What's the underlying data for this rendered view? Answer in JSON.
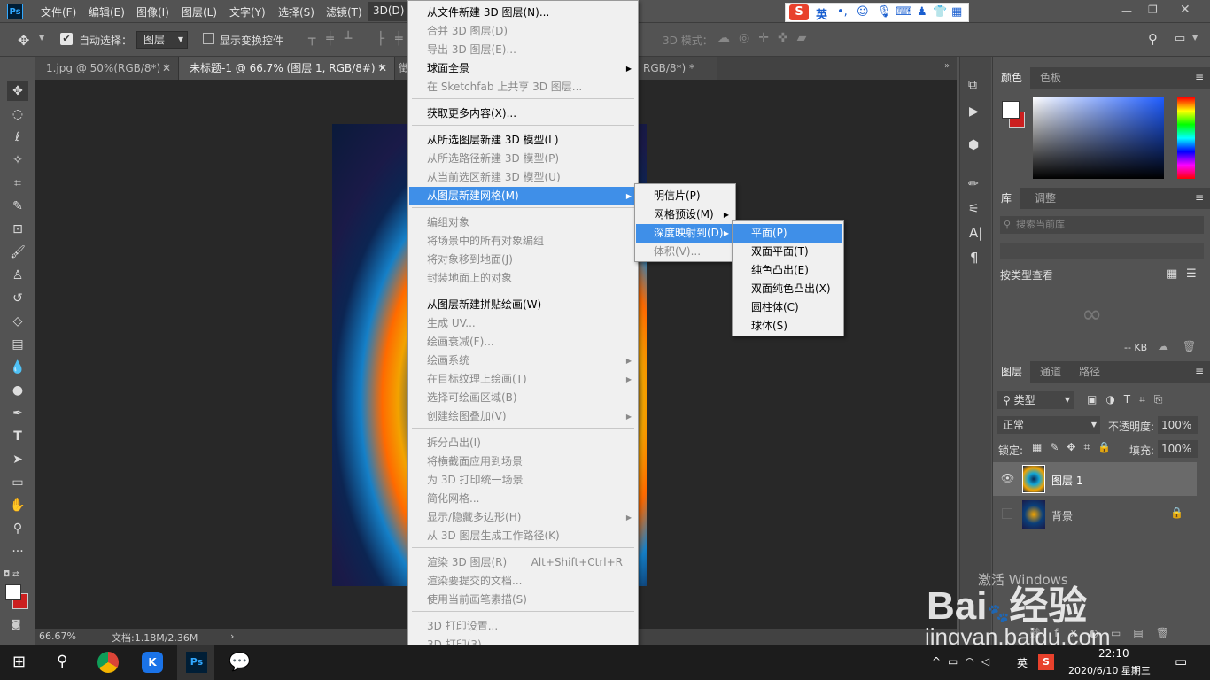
{
  "menubar": {
    "logo": "Ps",
    "items": [
      "文件(F)",
      "编辑(E)",
      "图像(I)",
      "图层(L)",
      "文字(Y)",
      "选择(S)",
      "滤镜(T)",
      "3D(D)"
    ]
  },
  "options": {
    "auto_select_label": "自动选择：",
    "auto_select_value": "图层",
    "show_transform_label": "显示变换控件",
    "mode_3d_label": "3D 模式："
  },
  "doc_tabs": [
    "1.jpg @ 50%(RGB/8*) *",
    "未标题-1 @ 66.7% (图层 1, RGB/8#) *",
    "徵",
    "RGB/8*) *"
  ],
  "status": {
    "zoom": "66.67%",
    "doc": "文档:1.18M/2.36M"
  },
  "menu_3d": {
    "items": [
      {
        "label": "从文件新建 3D 图层(N)...",
        "disabled": false
      },
      {
        "label": "合并 3D 图层(D)",
        "disabled": true
      },
      {
        "label": "导出 3D 图层(E)...",
        "disabled": true
      },
      {
        "label": "球面全景",
        "disabled": false,
        "submenu": true
      },
      {
        "label": "在 Sketchfab 上共享 3D 图层...",
        "disabled": true
      },
      {
        "label": "获取更多内容(X)...",
        "disabled": false
      },
      {
        "label": "从所选图层新建 3D 模型(L)",
        "disabled": false
      },
      {
        "label": "从所选路径新建 3D 模型(P)",
        "disabled": true
      },
      {
        "label": "从当前选区新建 3D 模型(U)",
        "disabled": true
      },
      {
        "label": "从图层新建网格(M)",
        "disabled": false,
        "submenu": true,
        "highlight": true
      },
      {
        "label": "编组对象",
        "disabled": true
      },
      {
        "label": "将场景中的所有对象编组",
        "disabled": true
      },
      {
        "label": "将对象移到地面(J)",
        "disabled": true
      },
      {
        "label": "封装地面上的对象",
        "disabled": true
      },
      {
        "label": "从图层新建拼贴绘画(W)",
        "disabled": false
      },
      {
        "label": "生成 UV...",
        "disabled": true
      },
      {
        "label": "绘画衰减(F)...",
        "disabled": true
      },
      {
        "label": "绘画系统",
        "disabled": true,
        "submenu": true
      },
      {
        "label": "在目标纹理上绘画(T)",
        "disabled": true,
        "submenu": true
      },
      {
        "label": "选择可绘画区域(B)",
        "disabled": true
      },
      {
        "label": "创建绘图叠加(V)",
        "disabled": true,
        "submenu": true
      },
      {
        "label": "拆分凸出(I)",
        "disabled": true
      },
      {
        "label": "将横截面应用到场景",
        "disabled": true
      },
      {
        "label": "为 3D 打印统一场景",
        "disabled": true
      },
      {
        "label": "简化网格...",
        "disabled": true
      },
      {
        "label": "显示/隐藏多边形(H)",
        "disabled": true,
        "submenu": true
      },
      {
        "label": "从 3D 图层生成工作路径(K)",
        "disabled": true
      },
      {
        "label": "渲染 3D 图层(R)",
        "disabled": true,
        "shortcut": "Alt+Shift+Ctrl+R"
      },
      {
        "label": "渲染要提交的文档...",
        "disabled": true
      },
      {
        "label": "使用当前画笔素描(S)",
        "disabled": true
      },
      {
        "label": "3D 打印设置...",
        "disabled": true
      },
      {
        "label": "3D 打印(3)...",
        "disabled": true
      }
    ]
  },
  "menu_mesh": {
    "items": [
      {
        "label": "明信片(P)",
        "submenu": false
      },
      {
        "label": "网格预设(M)",
        "submenu": true
      },
      {
        "label": "深度映射到(D)",
        "submenu": true,
        "highlight": true
      },
      {
        "label": "体积(V)...",
        "disabled": true
      }
    ]
  },
  "menu_depth": {
    "items": [
      {
        "label": "平面(P)",
        "highlight": true
      },
      {
        "label": "双面平面(T)"
      },
      {
        "label": "纯色凸出(E)"
      },
      {
        "label": "双面纯色凸出(X)"
      },
      {
        "label": "圆柱体(C)"
      },
      {
        "label": "球体(S)"
      }
    ]
  },
  "panels": {
    "color_tabs": [
      "颜色",
      "色板"
    ],
    "library_tabs": [
      "库",
      "调整"
    ],
    "library_search": "搜索当前库",
    "library_view": "按类型查看",
    "library_size": "-- KB",
    "layer_tabs": [
      "图层",
      "通道",
      "路径"
    ],
    "kind": "类型",
    "blend": "正常",
    "opacity_label": "不透明度:",
    "opacity_value": "100%",
    "lock_label": "锁定:",
    "fill_label": "填充:",
    "fill_value": "100%",
    "layers": [
      {
        "name": "图层 1",
        "selected": true
      },
      {
        "name": "背景",
        "selected": false
      }
    ]
  },
  "watermark": {
    "brand": "Bai",
    "cn": "经验",
    "url": "jingyan.baidu.com",
    "activate": "激活 Windows"
  },
  "ime": {
    "lang": "英"
  },
  "taskbar": {
    "time": "22:10",
    "date": "2020/6/10 星期三",
    "lang": "英"
  },
  "colors": {
    "highlight": "#3f8fe8",
    "fg_swatch": "#ffffff",
    "bg_swatch": "#cc1f1f"
  }
}
